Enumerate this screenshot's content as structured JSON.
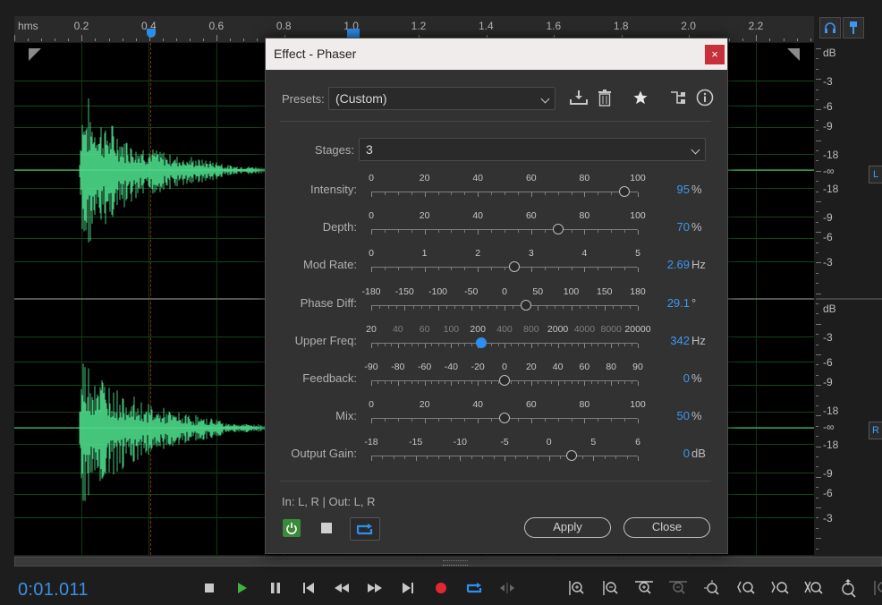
{
  "timeline": {
    "unit_label": "hms",
    "tick_labels": [
      "0.2",
      "0.4",
      "0.6",
      "0.8",
      "1.0",
      "1.2",
      "1.4",
      "1.6",
      "1.8",
      "2.0",
      "2.2"
    ]
  },
  "db_scale": {
    "top_channel": [
      "dB",
      "-3",
      "-6",
      "-9",
      "-18",
      "-∞",
      "-18",
      "-9",
      "-6",
      "-3"
    ],
    "bottom_channel": [
      "dB",
      "-3",
      "-6",
      "-9",
      "-18",
      "-∞",
      "-18",
      "-9",
      "-6",
      "-3"
    ],
    "channel_left": "L",
    "channel_right": "R"
  },
  "colors": {
    "waveform": "#4ddb8a",
    "accent_blue": "#2f8ff0",
    "close_red": "#c7303a",
    "power_green": "#3a8a3a"
  },
  "transport": {
    "timecode": "0:01.011",
    "buttons": [
      "stop-icon",
      "play-icon",
      "pause-icon",
      "skip-to-start-icon",
      "rewind-icon",
      "fast-forward-icon",
      "skip-to-end-icon",
      "record-icon",
      "loop-icon",
      "skip-selection-icon"
    ],
    "zoom_buttons": [
      "zoom-in-amplitude-icon",
      "zoom-out-amplitude-icon",
      "zoom-in-time-icon",
      "zoom-out-time-icon",
      "zoom-out-full-icon",
      "zoom-in-start-icon",
      "zoom-in-end-icon",
      "zoom-selection-icon",
      "zoom-to-selection-icon",
      "zoom-fit-icon"
    ]
  },
  "dialog": {
    "title": "Effect - Phaser",
    "close_glyph": "×",
    "presets_label": "Presets:",
    "preset_value": "(Custom)",
    "header_icons": [
      "download-preset-icon",
      "delete-preset-icon",
      "favorite-star-icon",
      "routing-icon",
      "info-icon"
    ],
    "stages_label": "Stages:",
    "stages_value": "3",
    "params": [
      {
        "label": "Intensity:",
        "scale": [
          "0",
          "20",
          "40",
          "60",
          "80",
          "100"
        ],
        "scale_dim": [
          false,
          false,
          false,
          false,
          false,
          false
        ],
        "value": "95",
        "unit": "%",
        "position": 0.95,
        "active": false
      },
      {
        "label": "Depth:",
        "scale": [
          "0",
          "20",
          "40",
          "60",
          "80",
          "100"
        ],
        "scale_dim": [
          false,
          false,
          false,
          false,
          false,
          false
        ],
        "value": "70",
        "unit": "%",
        "position": 0.7,
        "active": false
      },
      {
        "label": "Mod Rate:",
        "scale": [
          "0",
          "1",
          "2",
          "3",
          "4",
          "5"
        ],
        "scale_dim": [
          false,
          false,
          false,
          false,
          false,
          false
        ],
        "value": "2.69",
        "unit": "Hz",
        "position": 0.538,
        "active": false
      },
      {
        "label": "Phase Diff:",
        "scale": [
          "-180",
          "-150",
          "-100",
          "-50",
          "0",
          "50",
          "100",
          "150",
          "180"
        ],
        "scale_dim": [
          false,
          false,
          false,
          false,
          false,
          false,
          false,
          false,
          false
        ],
        "value": "29.1",
        "unit": "°",
        "position": 0.581,
        "active": false
      },
      {
        "label": "Upper Freq:",
        "scale": [
          "20",
          "40",
          "60",
          "100",
          "200",
          "400",
          "800",
          "2000",
          "4000",
          "8000",
          "20000"
        ],
        "scale_dim": [
          false,
          true,
          true,
          true,
          false,
          true,
          true,
          false,
          true,
          true,
          false
        ],
        "value": "342",
        "unit": "Hz",
        "position": 0.412,
        "active": true
      },
      {
        "label": "Feedback:",
        "scale": [
          "-90",
          "-80",
          "-60",
          "-40",
          "-20",
          "0",
          "20",
          "40",
          "60",
          "80",
          "90"
        ],
        "scale_dim": [
          false,
          false,
          false,
          false,
          false,
          false,
          false,
          false,
          false,
          false,
          false
        ],
        "value": "0",
        "unit": "%",
        "position": 0.5,
        "active": false
      },
      {
        "label": "Mix:",
        "scale": [
          "0",
          "20",
          "40",
          "60",
          "80",
          "100"
        ],
        "scale_dim": [
          false,
          false,
          false,
          false,
          false,
          false
        ],
        "value": "50",
        "unit": "%",
        "position": 0.5,
        "active": false
      },
      {
        "label": "Output Gain:",
        "scale": [
          "-18",
          "-15",
          "-10",
          "-5",
          "0",
          "5",
          "6"
        ],
        "scale_dim": [
          false,
          false,
          false,
          false,
          false,
          false,
          false
        ],
        "value": "0",
        "unit": "dB",
        "position": 0.75,
        "active": false
      }
    ],
    "io_text": "In: L, R | Out: L, R",
    "apply_label": "Apply",
    "close_label": "Close"
  }
}
